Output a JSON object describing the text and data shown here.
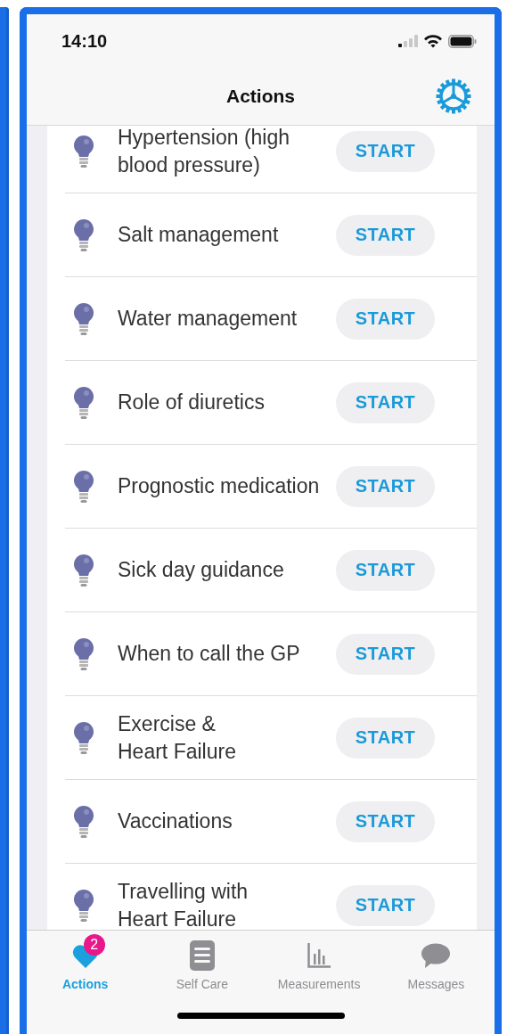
{
  "status_bar": {
    "time": "14:10"
  },
  "nav_bar": {
    "title": "Actions"
  },
  "actions": [
    {
      "label": "Hypertension (high blood pressure)",
      "button": "START"
    },
    {
      "label": "Salt management",
      "button": "START"
    },
    {
      "label": "Water management",
      "button": "START"
    },
    {
      "label": "Role of diuretics",
      "button": "START"
    },
    {
      "label": "Prognostic medication",
      "button": "START"
    },
    {
      "label": "Sick day guidance",
      "button": "START"
    },
    {
      "label": "When to call the GP",
      "button": "START"
    },
    {
      "label": "Exercise &\nHeart Failure",
      "button": "START"
    },
    {
      "label": "Vaccinations",
      "button": "START"
    },
    {
      "label": "Travelling with\nHeart Failure",
      "button": "START"
    }
  ],
  "tab_bar": [
    {
      "label": "Actions",
      "selected": true,
      "badge": "2"
    },
    {
      "label": "Self Care",
      "selected": false
    },
    {
      "label": "Measurements",
      "selected": false
    },
    {
      "label": "Messages",
      "selected": false
    }
  ]
}
